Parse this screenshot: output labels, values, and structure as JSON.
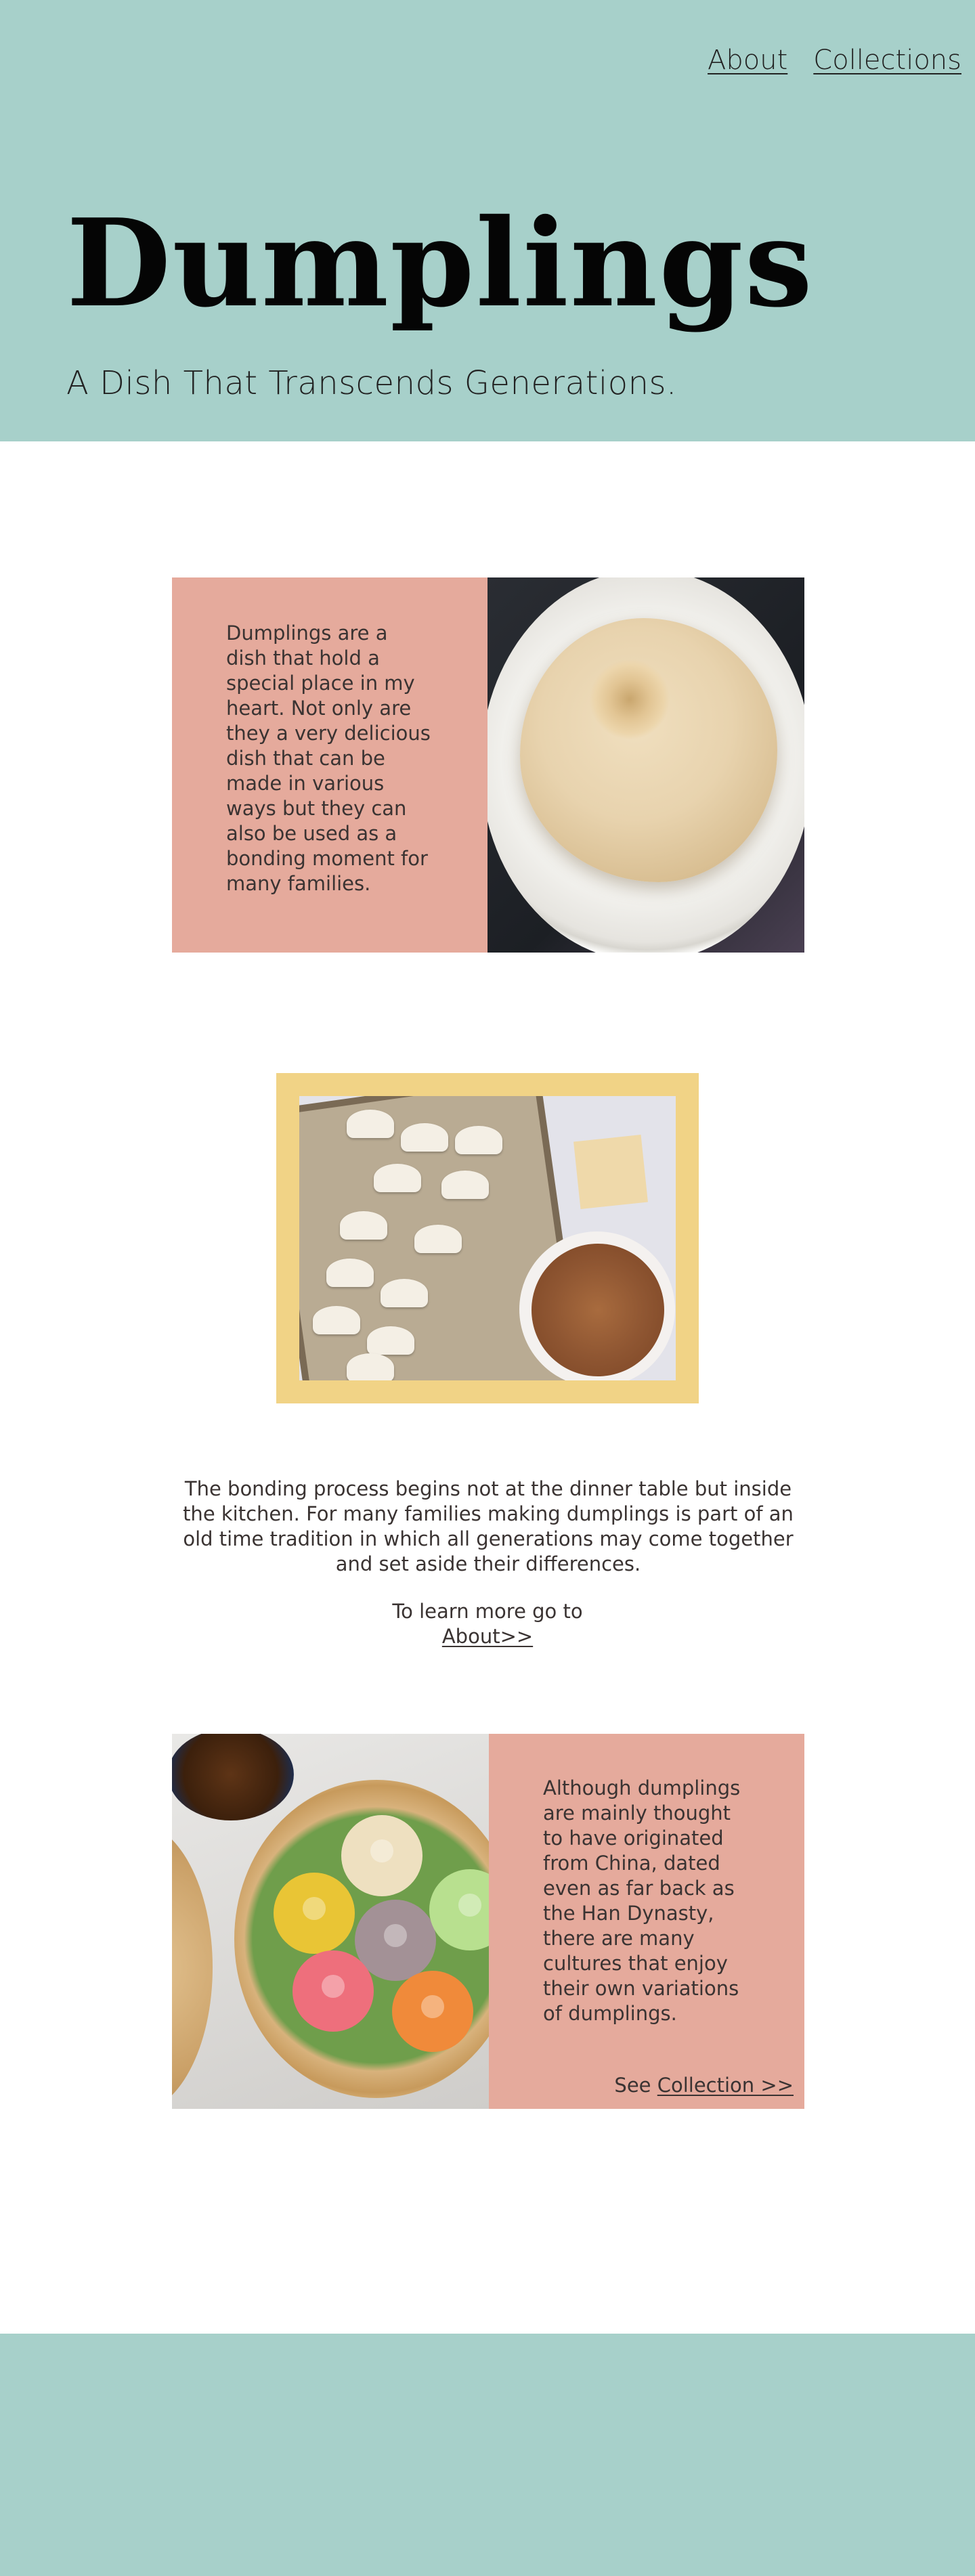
{
  "nav": {
    "items": [
      {
        "label": "About"
      },
      {
        "label": "Collections"
      }
    ]
  },
  "hero": {
    "title": "Dumplings",
    "subtitle": "A Dish That Transcends Generations."
  },
  "section1": {
    "text": "Dumplings are a dish that hold a special place in my heart. Not only are they a very delicious dish that can be made in various ways but they can also be used as a bonding moment for many families.",
    "image": "soup-dumpling-on-plate-photo"
  },
  "section2": {
    "image": "dumpling-making-tray-photo",
    "text": "The bonding process begins not at the dinner table but inside the kitchen. For many families making dumplings is part of an old time tradition in which all generations may come together and set aside their differences.",
    "learn_prefix": "To learn more go to",
    "learn_link": "About>>"
  },
  "section3": {
    "image": "colorful-dumplings-steamer-photo",
    "text": "Although dumplings are mainly thought to have originated from China, dated even as far back as the Han Dynasty, there are many cultures that enjoy their own variations of dumplings.",
    "see_prefix": "See",
    "see_link": "Collection >>"
  },
  "colors": {
    "teal": "#a7d0ca",
    "pink": "#e5aa9c",
    "yellow": "#f1d386"
  }
}
